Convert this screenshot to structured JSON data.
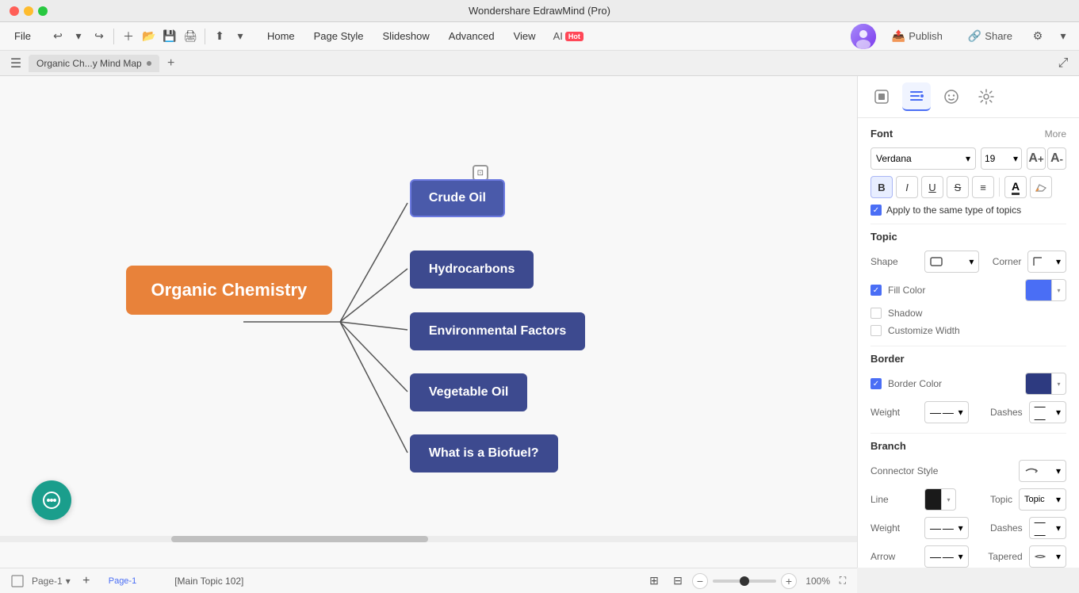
{
  "app": {
    "title": "Wondershare EdrawMind (Pro)",
    "tab_label": "Organic Ch...y Mind Map",
    "tab_modified_dot": true
  },
  "menu": {
    "file": "File",
    "home": "Home",
    "page_style": "Page Style",
    "slideshow": "Slideshow",
    "advanced": "Advanced",
    "view": "View",
    "ai": "AI",
    "hot": "Hot",
    "publish": "Publish",
    "share": "Share"
  },
  "mindmap": {
    "central_node": "Organic Chemistry",
    "topics": [
      {
        "label": "Crude Oil",
        "selected": true
      },
      {
        "label": "Hydrocarbons",
        "selected": false
      },
      {
        "label": "Environmental Factors",
        "selected": false
      },
      {
        "label": "Vegetable Oil",
        "selected": false
      },
      {
        "label": "What is a Biofuel?",
        "selected": false
      }
    ]
  },
  "right_panel": {
    "font_section": "Font",
    "more_label": "More",
    "font_name": "Verdana",
    "font_size": "19",
    "apply_same_topics": "Apply to the same type of topics",
    "topic_section": "Topic",
    "shape_label": "Shape",
    "corner_label": "Corner",
    "fill_color_label": "Fill Color",
    "fill_color": "#4a6ef5",
    "shadow_label": "Shadow",
    "customize_width_label": "Customize Width",
    "border_section": "Border",
    "border_color_label": "Border Color",
    "border_color": "#2d3a80",
    "weight_label": "Weight",
    "dashes_label": "Dashes",
    "branch_section": "Branch",
    "connector_style_label": "Connector Style",
    "line_label": "Line",
    "line_color": "#1a1a1a",
    "topic_dropdown": "Topic",
    "weight2_label": "Weight",
    "dashes2_label": "Dashes",
    "arrow_label": "Arrow",
    "tapered_label": "Tapered"
  },
  "status": {
    "main_topic": "[Main Topic 102]",
    "page_label": "Page-1",
    "page_tab": "Page-1",
    "zoom": "100%"
  }
}
